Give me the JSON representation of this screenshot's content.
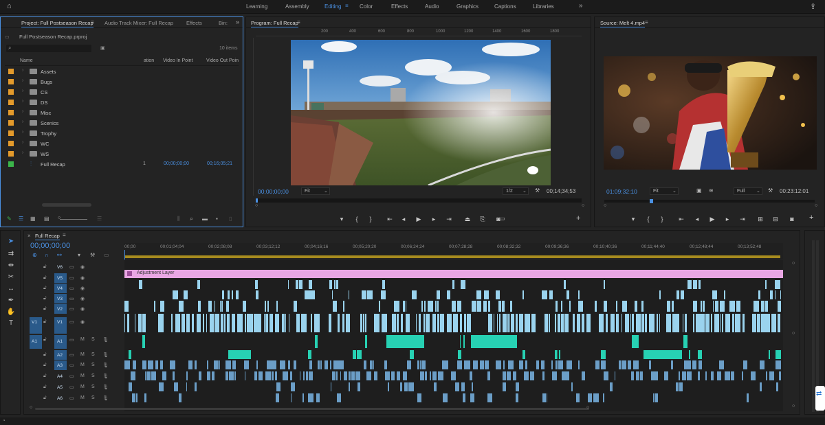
{
  "workspaces": [
    "Learning",
    "Assembly",
    "Editing",
    "Color",
    "Effects",
    "Audio",
    "Graphics",
    "Captions",
    "Libraries"
  ],
  "active_workspace": "Editing",
  "project_panel": {
    "tabs": [
      "Project: Full Postseason Recap",
      "Audio Track Mixer: Full Recap",
      "Effects",
      "Bin:"
    ],
    "project_file": "Full Postseason Recap.prproj",
    "item_count": "10 items",
    "columns": [
      "Name",
      "ation",
      "Video In Point",
      "Video Out Poin"
    ],
    "bins": [
      "Assets",
      "Bugs",
      "CS",
      "DS",
      "Misc",
      "Scenics",
      "Trophy",
      "WC",
      "WS"
    ],
    "sequence": {
      "name": "Full Recap",
      "count": "1",
      "in": "00;00;00;00",
      "out": "00;16;05;21"
    }
  },
  "program_monitor": {
    "title": "Program: Full Recap",
    "ruler_marks": [
      "200",
      "400",
      "600",
      "800",
      "1000",
      "1200",
      "1400",
      "1600",
      "1800"
    ],
    "timecode": "00;00;00;00",
    "fit": "Fit",
    "resolution": "1/2",
    "duration": "00;14;34;53"
  },
  "source_monitor": {
    "title": "Source: Melt 4.mp4",
    "timecode": "01:09:32:10",
    "fit": "Fit",
    "resolution": "Full",
    "duration": "00:23:12:01"
  },
  "timeline": {
    "sequence_tab": "Full Recap",
    "timecode": "00;00;00;00",
    "ruler": [
      "00;00",
      "00;01;04;04",
      "00;02;08;08",
      "00;03;12;12",
      "00;04;16;16",
      "00;05;20;20",
      "00;06;24;24",
      "00;07;28;28",
      "00;08;32;32",
      "00;09;36;36",
      "00;10;40;36",
      "00;11;44;40",
      "00;12;48;44",
      "00;13;52;48"
    ],
    "video_tracks": [
      "V6",
      "V5",
      "V4",
      "V3",
      "V2",
      "V1"
    ],
    "audio_tracks": [
      "A1",
      "A2",
      "A3",
      "A4",
      "A5",
      "A6"
    ],
    "source_patch_v": "V1",
    "source_patch_a": "A1",
    "adjustment_clip": "Adjustment Layer",
    "track_buttons": {
      "mute": "M",
      "solo": "S"
    }
  },
  "colors": {
    "accent": "#4a90e2",
    "bin_label": "#e39a2b",
    "sequence_label": "#3bb54a",
    "adjustment": "#e9a6e3",
    "video_clip": "#9ad3ee",
    "audio_clip": "#27d1b3"
  }
}
